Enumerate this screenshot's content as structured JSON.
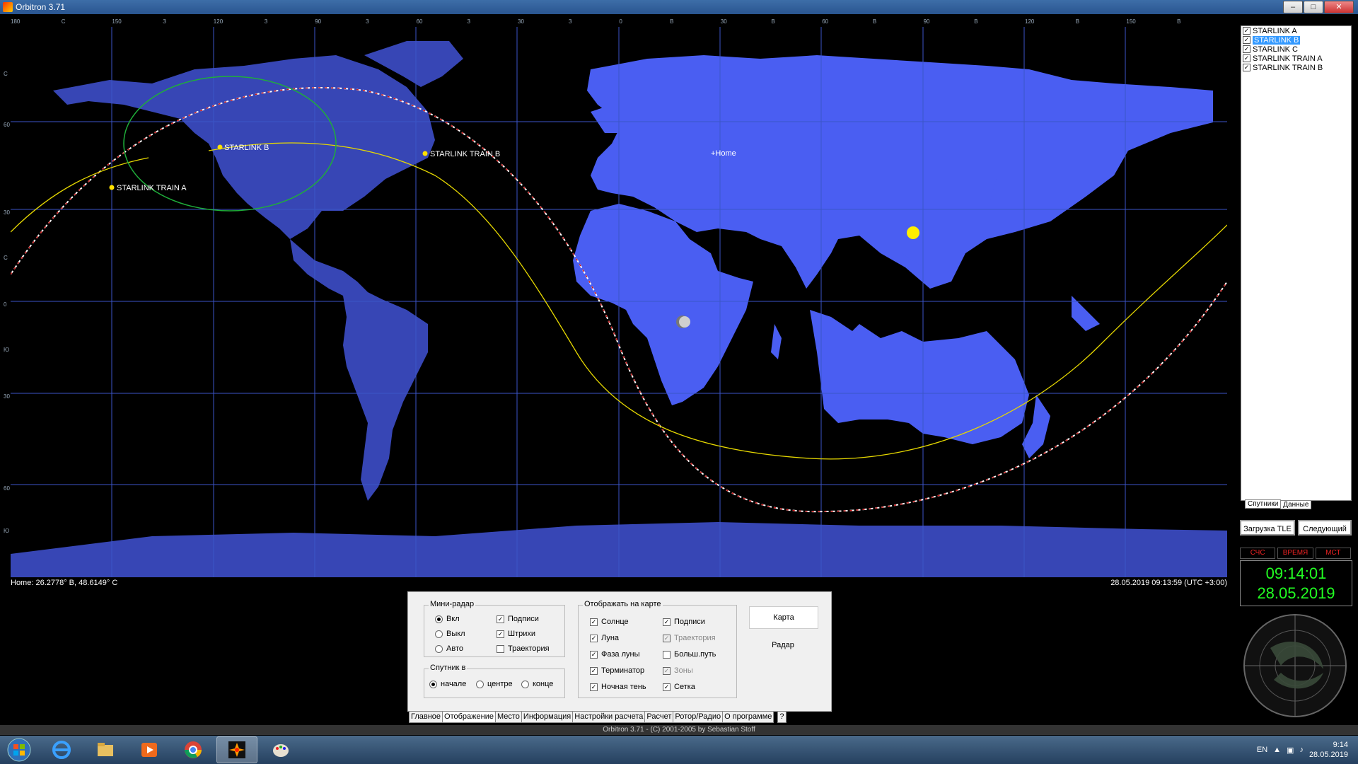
{
  "window": {
    "title": "Orbitron 3.71",
    "minimize": "‒",
    "maximize": "□",
    "close": "✕"
  },
  "map": {
    "longitude_ticks": [
      "180",
      "С",
      "150",
      "З",
      "120",
      "З",
      "90",
      "З",
      "60",
      "З",
      "30",
      "З",
      "0",
      "В",
      "30",
      "В",
      "60",
      "В",
      "90",
      "В",
      "120",
      "В",
      "150",
      "В"
    ],
    "latitude_ticks": [
      "С",
      "60",
      "30",
      "С",
      "0",
      "Ю",
      "30",
      "60",
      "Ю"
    ],
    "labels": {
      "starlink_a_b": "STARLINK B",
      "starlink_train_a": "STARLINK TRAIN A",
      "starlink_train_b": "STARLINK TRAIN B",
      "home": "+Home"
    },
    "home_text": "Home: 26.2778° В, 48.6149° С",
    "datetime_text": "28.05.2019 09:13:59 (UTC +3:00)",
    "colors": {
      "land": "#4a5ef2",
      "night_land": "#3646b8",
      "grid": "#3b55c8",
      "ocean": "#000000",
      "sun": "#ffee00"
    }
  },
  "satellites": {
    "items": [
      {
        "name": "STARLINK A",
        "check": "✓",
        "selected": false
      },
      {
        "name": "STARLINK B",
        "check": "✓",
        "selected": true
      },
      {
        "name": "STARLINK C",
        "check": "✓",
        "selected": false
      },
      {
        "name": "STARLINK TRAIN A",
        "check": "✓",
        "selected": false
      },
      {
        "name": "STARLINK TRAIN B",
        "check": "✓",
        "selected": false
      }
    ],
    "tabs": [
      "Спутники",
      "Данные"
    ]
  },
  "buttons": {
    "load_tle": "Загрузка TLE",
    "next": "Следующий"
  },
  "clock": {
    "headers": [
      "СЧС",
      "ВРЕМЯ",
      "МСТ"
    ],
    "time": "09:14:01",
    "date": "28.05.2019"
  },
  "panel": {
    "mini_radar": {
      "title": "Мини-радар",
      "radios": [
        {
          "label": "Вкл",
          "on": true
        },
        {
          "label": "Выкл",
          "on": false
        },
        {
          "label": "Авто",
          "on": false
        }
      ],
      "checks": [
        {
          "label": "Подписи",
          "check": "✓"
        },
        {
          "label": "Штрихи",
          "check": "✓"
        },
        {
          "label": "Траектория",
          "check": ""
        }
      ]
    },
    "satellite_in": {
      "title": "Спутник в",
      "radios": [
        {
          "label": "начале",
          "on": true
        },
        {
          "label": "центре",
          "on": false
        },
        {
          "label": "конце",
          "on": false
        }
      ]
    },
    "display": {
      "title": "Отображать на карте",
      "left": [
        {
          "label": "Солнце",
          "check": "✓"
        },
        {
          "label": "Луна",
          "check": "✓"
        },
        {
          "label": "Фаза луны",
          "check": "✓"
        },
        {
          "label": "Терминатор",
          "check": "✓"
        },
        {
          "label": "Ночная тень",
          "check": "✓"
        }
      ],
      "right": [
        {
          "label": "Подписи",
          "check": "✓"
        },
        {
          "label": "Траектория",
          "check": "✓"
        },
        {
          "label": "Больш.путь",
          "check": ""
        },
        {
          "label": "Зоны",
          "check": "✓"
        },
        {
          "label": "Сетка",
          "check": "✓"
        }
      ]
    },
    "view_buttons": {
      "map": "Карта",
      "radar": "Радар"
    }
  },
  "bottom_tabs": [
    "Главное",
    "Отображение",
    "Место",
    "Информация",
    "Настройки расчета",
    "Расчет",
    "Ротор/Радио",
    "О программе",
    "?"
  ],
  "credit": "Orbitron 3.71 - (C) 2001-2005 by Sebastian Stoff",
  "taskbar": {
    "lang": "EN",
    "time": "9:14",
    "date": "28.05.2019"
  }
}
